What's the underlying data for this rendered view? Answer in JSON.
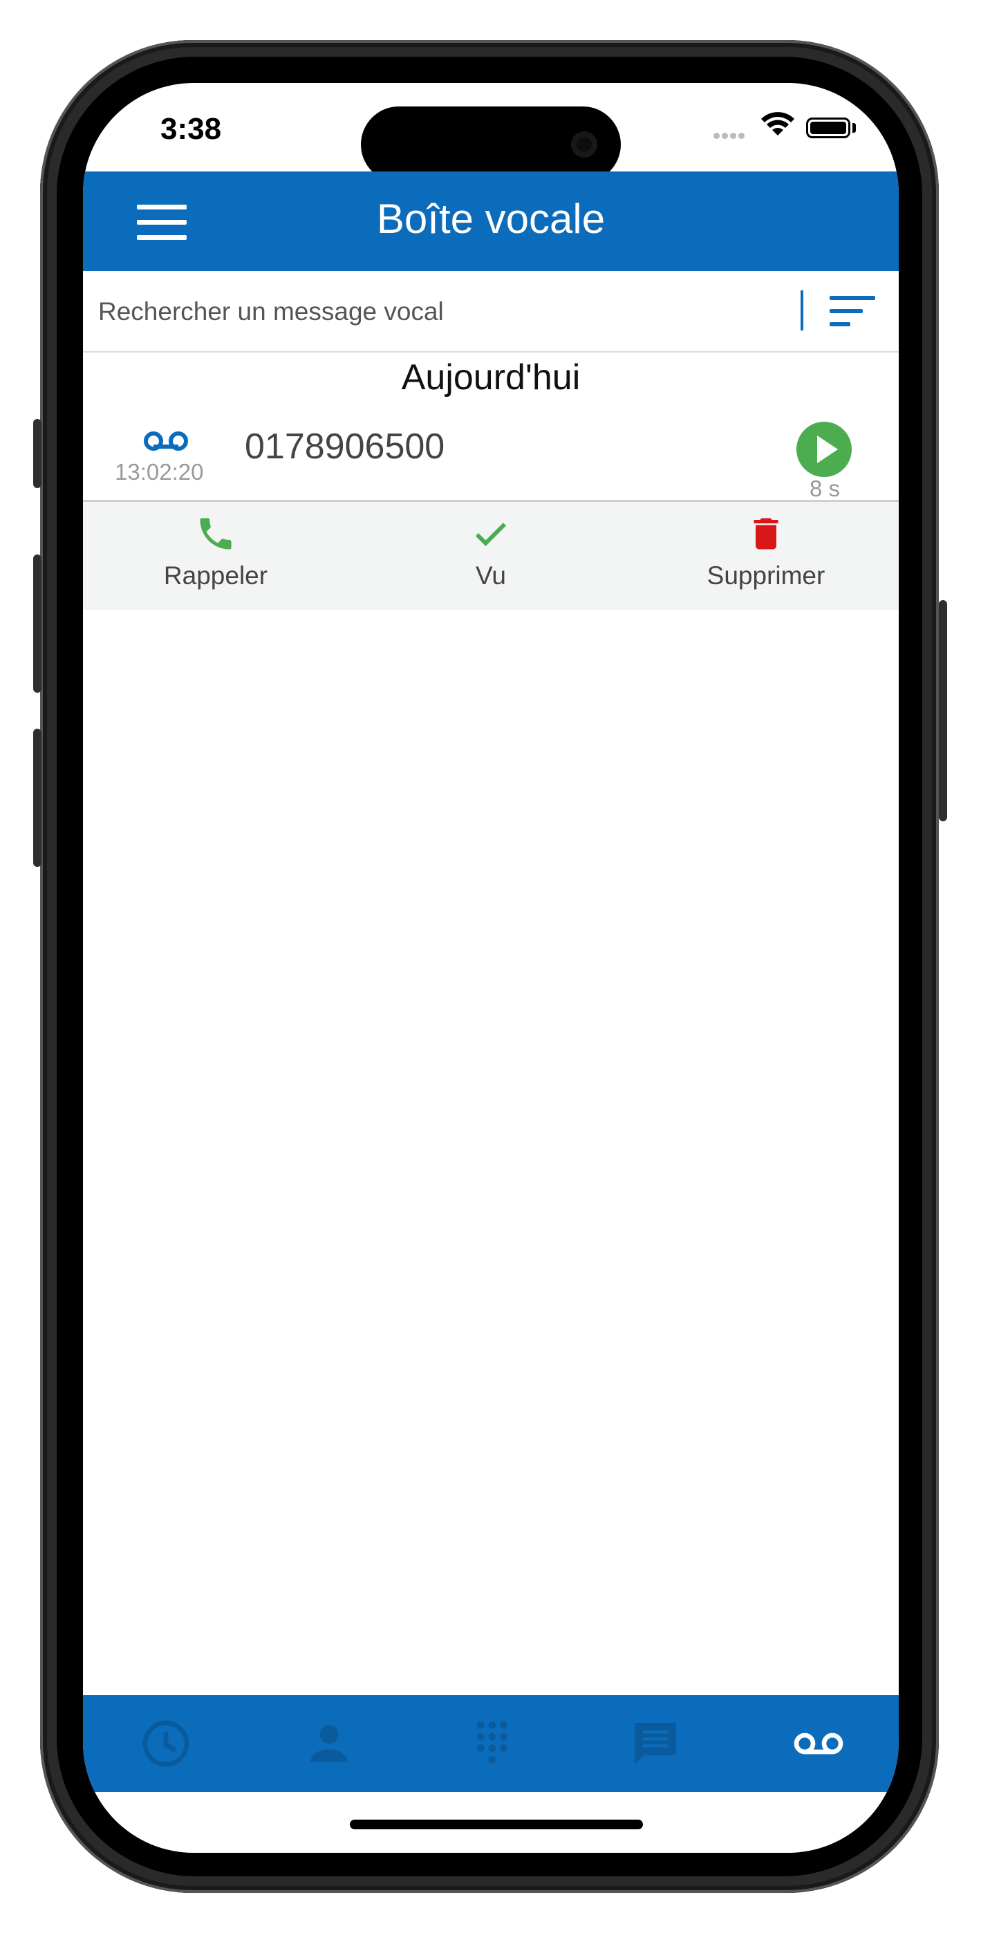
{
  "status_bar": {
    "time": "3:38"
  },
  "header": {
    "title": "Boîte vocale"
  },
  "search": {
    "placeholder": "Rechercher un message vocal"
  },
  "voicemails": {
    "section_title": "Aujourd'hui",
    "items": [
      {
        "time": "13:02:20",
        "number": "0178906500",
        "duration": "8 s"
      }
    ]
  },
  "actions": {
    "callback": "Rappeler",
    "seen": "Vu",
    "delete": "Supprimer"
  },
  "tabs": [
    "history",
    "contacts",
    "keypad",
    "messages",
    "voicemail"
  ],
  "active_tab": "voicemail",
  "colors": {
    "primary": "#0b6cbc",
    "tab_inactive": "#0a5a9c",
    "success": "#4cad50",
    "danger": "#d81818",
    "action_bar_bg": "#f3f4f4"
  }
}
